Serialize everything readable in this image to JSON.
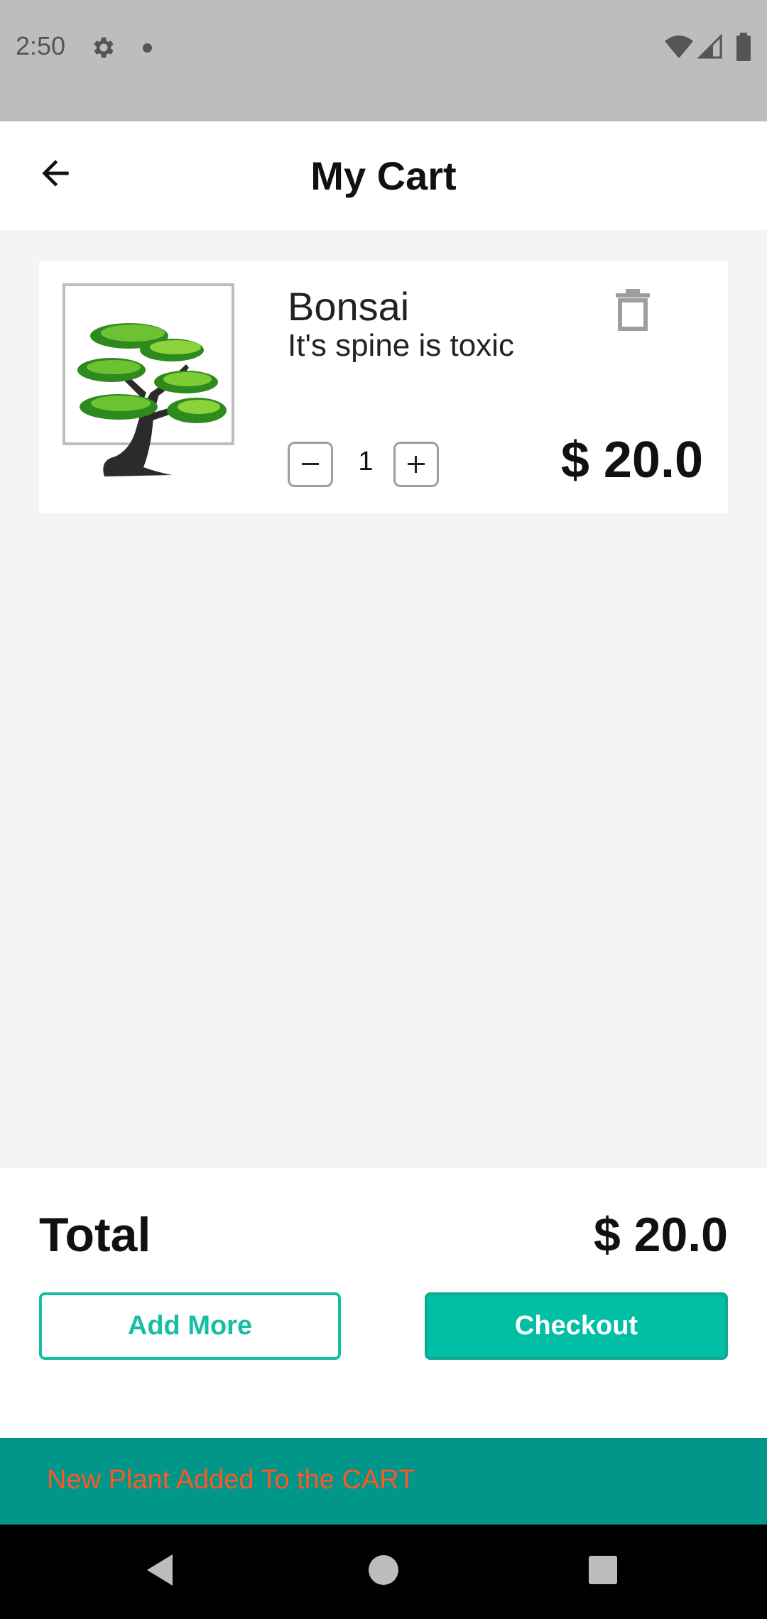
{
  "status_bar": {
    "time": "2:50"
  },
  "header": {
    "title": "My Cart"
  },
  "cart": {
    "items": [
      {
        "name": "Bonsai",
        "description": "It's spine is toxic",
        "quantity": "1",
        "price": "$ 20.0",
        "image_icon": "bonsai-tree-image"
      }
    ]
  },
  "summary": {
    "total_label": "Total",
    "total_value": "$ 20.0",
    "add_more_label": "Add More",
    "checkout_label": "Checkout"
  },
  "snackbar": {
    "message": "New Plant Added To the CART"
  },
  "colors": {
    "accent": "#00bfa5",
    "snackbar_bg": "#00968a",
    "snackbar_text": "#ff5722",
    "status_bar": "#bdbdbd"
  }
}
